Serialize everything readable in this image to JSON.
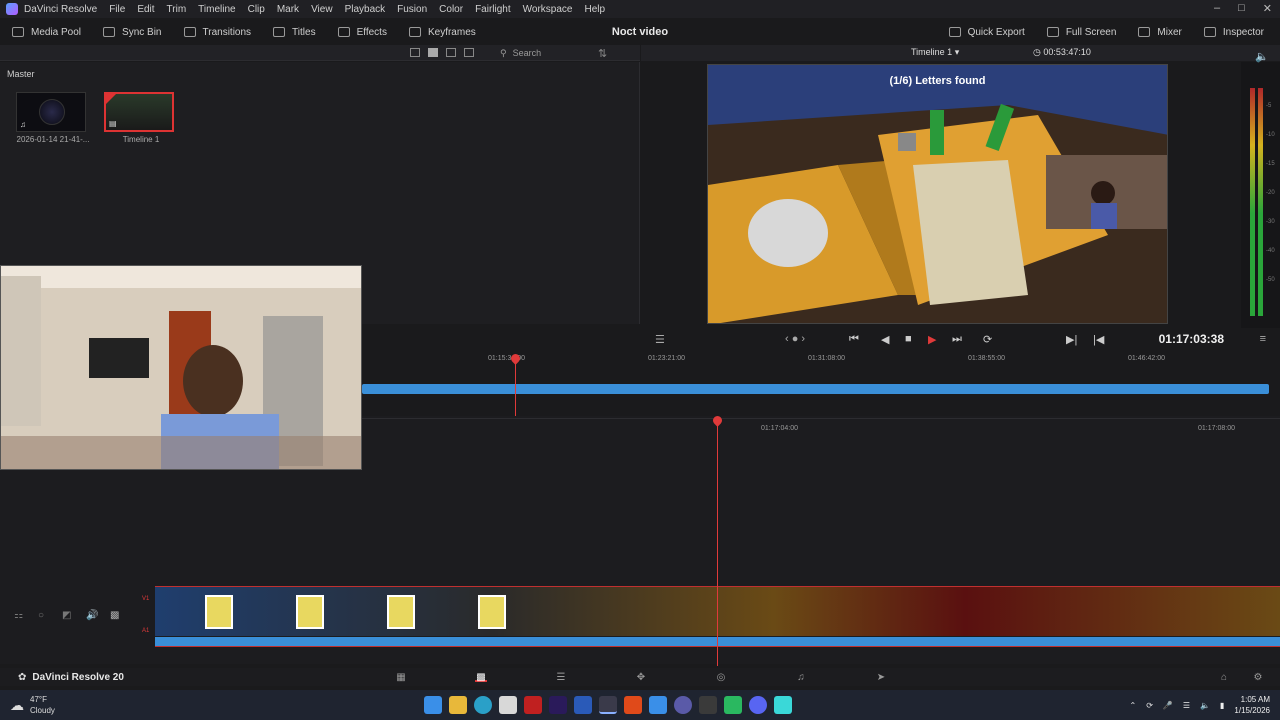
{
  "menu": {
    "app_name": "DaVinci Resolve",
    "items": [
      "File",
      "Edit",
      "Trim",
      "Timeline",
      "Clip",
      "Mark",
      "View",
      "Playback",
      "Fusion",
      "Color",
      "Fairlight",
      "Workspace",
      "Help"
    ]
  },
  "toolbar": {
    "left": [
      "Media Pool",
      "Sync Bin",
      "Transitions",
      "Titles",
      "Effects",
      "Keyframes"
    ],
    "project_title": "Noct video",
    "right": [
      "Quick Export",
      "Full Screen",
      "Mixer",
      "Inspector"
    ]
  },
  "media_pool": {
    "master": "Master",
    "search_placeholder": "Search",
    "clips": [
      {
        "caption": "2026-01-14 21-41-..."
      },
      {
        "caption": "Timeline 1"
      }
    ]
  },
  "viewer": {
    "timeline_name": "Timeline 1",
    "duration_tc": "00:53:47:10",
    "overlay_text": "(1/6) Letters found",
    "current_tc": "01:17:03:38"
  },
  "meter_labels": [
    "-5",
    "-10",
    "-15",
    "-20",
    "-30",
    "-40",
    "-50"
  ],
  "timeline": {
    "upper_ticks": [
      "01:15:34:00",
      "01:23:21:00",
      "01:31:08:00",
      "01:38:55:00",
      "01:46:42:00"
    ],
    "lower_ticks": [
      "01:17:04:00",
      "01:17:08:00"
    ],
    "track_labels": [
      "V1",
      "A1"
    ]
  },
  "pagebar": {
    "brand": "DaVinci Resolve 20"
  },
  "taskbar": {
    "temperature": "47°F",
    "condition": "Cloudy",
    "time": "1:05 AM",
    "date": "1/15/2026"
  },
  "colors": {
    "accent_red": "#e03a3a",
    "track_blue": "#3a8fd8",
    "bg": "#1a1a1c"
  }
}
